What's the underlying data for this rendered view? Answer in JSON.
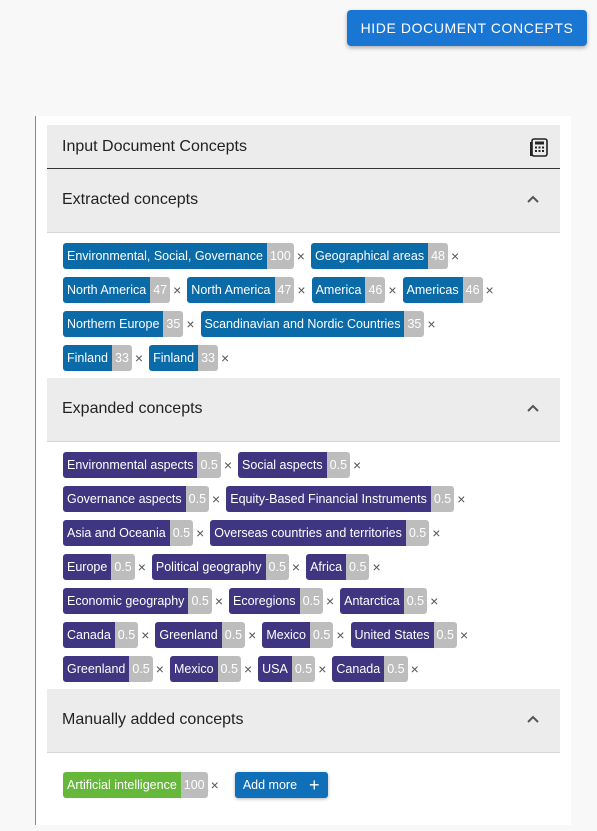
{
  "hide_button": {
    "label": "HIDE DOCUMENT CONCEPTS"
  },
  "panel": {
    "title": "Input Document Concepts",
    "icon": "calculator-icon",
    "sections": {
      "extracted": {
        "title": "Extracted concepts",
        "rows": [
          [
            {
              "label": "Environmental, Social, Governance",
              "count": "100"
            },
            {
              "label": "Geographical areas",
              "count": "48"
            }
          ],
          [
            {
              "label": "North America",
              "count": "47"
            },
            {
              "label": "North America",
              "count": "47"
            },
            {
              "label": "America",
              "count": "46"
            },
            {
              "label": "Americas",
              "count": "46"
            }
          ],
          [
            {
              "label": "Northern Europe",
              "count": "35"
            },
            {
              "label": "Scandinavian and Nordic Countries",
              "count": "35"
            }
          ],
          [
            {
              "label": "Finland",
              "count": "33"
            },
            {
              "label": "Finland",
              "count": "33"
            }
          ]
        ]
      },
      "expanded": {
        "title": "Expanded concepts",
        "rows": [
          [
            {
              "label": "Environmental aspects",
              "count": "0.5"
            },
            {
              "label": "Social aspects",
              "count": "0.5"
            }
          ],
          [
            {
              "label": "Governance aspects",
              "count": "0.5"
            },
            {
              "label": "Equity-Based Financial Instruments",
              "count": "0.5"
            }
          ],
          [
            {
              "label": "Asia and Oceania",
              "count": "0.5"
            },
            {
              "label": "Overseas countries and territories",
              "count": "0.5"
            }
          ],
          [
            {
              "label": "Europe",
              "count": "0.5"
            },
            {
              "label": "Political geography",
              "count": "0.5"
            },
            {
              "label": "Africa",
              "count": "0.5"
            }
          ],
          [
            {
              "label": "Economic geography",
              "count": "0.5"
            },
            {
              "label": "Ecoregions",
              "count": "0.5"
            },
            {
              "label": "Antarctica",
              "count": "0.5"
            }
          ],
          [
            {
              "label": "Canada",
              "count": "0.5"
            },
            {
              "label": "Greenland",
              "count": "0.5"
            },
            {
              "label": "Mexico",
              "count": "0.5"
            },
            {
              "label": "United States",
              "count": "0.5"
            }
          ],
          [
            {
              "label": "Greenland",
              "count": "0.5"
            },
            {
              "label": "Mexico",
              "count": "0.5"
            },
            {
              "label": "USA",
              "count": "0.5"
            },
            {
              "label": "Canada",
              "count": "0.5"
            }
          ]
        ]
      },
      "manual": {
        "title": "Manually added concepts",
        "rows": [
          [
            {
              "label": "Artificial intelligence",
              "count": "100"
            }
          ]
        ],
        "add_label": "Add more"
      }
    }
  },
  "colors": {
    "extracted_chip": "#0b6aa8",
    "expanded_chip": "#3f3580",
    "manual_chip": "#66b83a",
    "count_badge": "#bdbdbd",
    "primary": "#1976d2"
  },
  "remove_glyph": "×"
}
